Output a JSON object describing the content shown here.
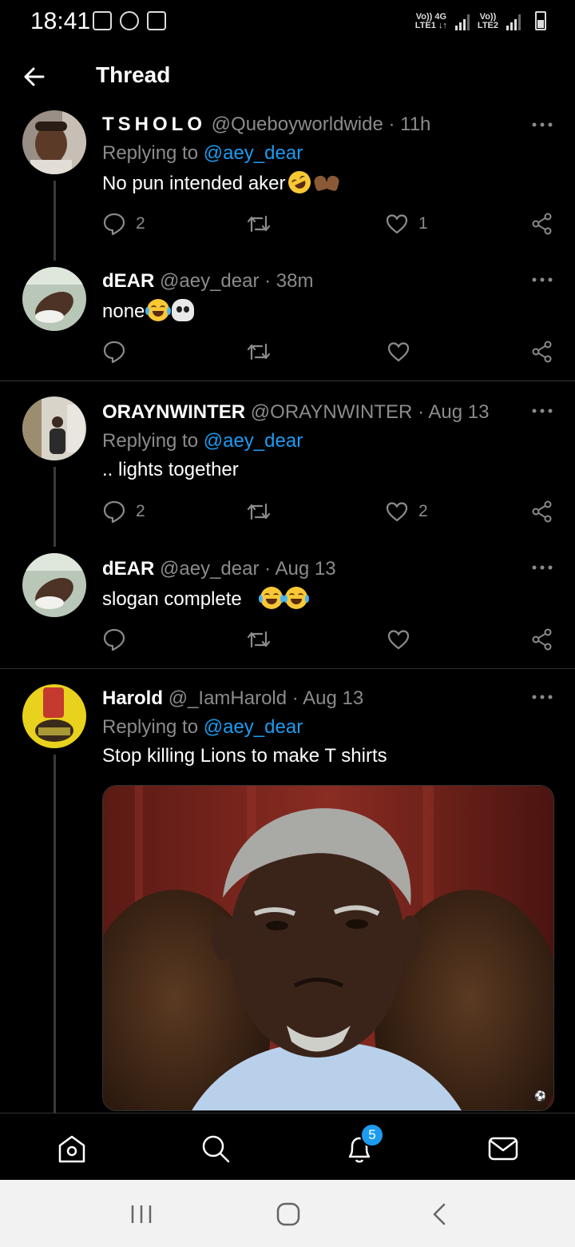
{
  "status_bar": {
    "time": "18:41",
    "sim1_label_top": "Vo)) 4G",
    "sim1_label_bottom": "LTE1 ↓↑",
    "sim2_label_top": "Vo))",
    "sim2_label_bottom": "LTE2"
  },
  "header": {
    "title": "Thread",
    "back_icon": "arrow-left-icon"
  },
  "tweets": [
    {
      "name": "TSHOLO",
      "handle": "@Queboyworldwide",
      "time": "· 11h",
      "replying_prefix": "Replying to ",
      "replying_to": "@aey_dear",
      "text": "No pun intended aker",
      "emojis": [
        "rofl-emoji",
        "raised-hands-emoji"
      ],
      "replies": "2",
      "retweets": "",
      "likes": "1"
    },
    {
      "name": "dEAR",
      "handle": "@aey_dear",
      "time": "· 38m",
      "text": "none",
      "emojis": [
        "tears-of-joy-emoji",
        "skull-emoji"
      ],
      "replies": "",
      "retweets": "",
      "likes": ""
    },
    {
      "name": "ORAYNWINTER",
      "handle": "@ORAYNWINTER",
      "time": "· Aug 13",
      "replying_prefix": "Replying to ",
      "replying_to": "@aey_dear",
      "text": ".. lights together",
      "replies": "2",
      "retweets": "",
      "likes": "2"
    },
    {
      "name": "dEAR",
      "handle": "@aey_dear",
      "time": "· Aug 13",
      "text": "slogan complete",
      "emojis": [
        "tears-of-joy-emoji",
        "tears-of-joy-emoji"
      ],
      "replies": "",
      "retweets": "",
      "likes": ""
    },
    {
      "name": "Harold",
      "handle": "@_IamHarold",
      "time": "· Aug 13",
      "replying_prefix": "Replying to ",
      "replying_to": "@aey_dear",
      "text": "Stop killing Lions to make T shirts",
      "media": "photo-of-elderly-man"
    }
  ],
  "bottom_nav": {
    "items": [
      "home-icon",
      "search-icon",
      "notifications-icon",
      "messages-icon"
    ],
    "notification_count": "5"
  },
  "system_nav": {
    "items": [
      "recent-apps-icon",
      "home-circle-icon",
      "back-chevron-icon"
    ]
  },
  "colors": {
    "background": "#000000",
    "accent": "#1d9bf0",
    "secondary_text": "#8b8b8b",
    "divider": "#2f3336"
  }
}
